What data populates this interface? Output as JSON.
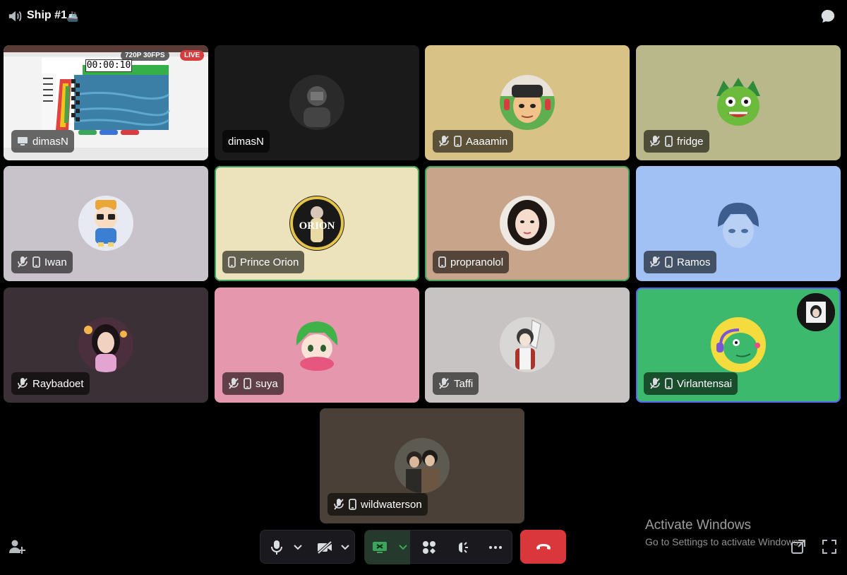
{
  "header": {
    "title": "Ship #1",
    "flag": "🚢",
    "speaker_icon": "speaker-icon",
    "chat_icon": "chat-bubble-icon"
  },
  "stream": {
    "name": "dimasN",
    "resolution": "720P 30FPS",
    "live_label": "LIVE",
    "timer": "00:00:10",
    "kind": "screen-share"
  },
  "participants": [
    {
      "name": "dimasN",
      "muted": false,
      "mobile": false,
      "bg": "#1a1a1a"
    },
    {
      "name": "Aaaamin",
      "muted": true,
      "mobile": true,
      "bg": "#d8c286"
    },
    {
      "name": "fridge",
      "muted": true,
      "mobile": true,
      "bg": "#b9b88b"
    },
    {
      "name": "Iwan",
      "muted": true,
      "mobile": true,
      "bg": "#c8c3cb"
    },
    {
      "name": "Prince Orion",
      "muted": false,
      "mobile": true,
      "bg": "#ece3bd",
      "speaking": true
    },
    {
      "name": "propranolol",
      "muted": false,
      "mobile": true,
      "bg": "#c8a48a",
      "speaking": true
    },
    {
      "name": "Ramos",
      "muted": true,
      "mobile": true,
      "bg": "#a1c0f4"
    },
    {
      "name": "Raybadoet",
      "muted": true,
      "mobile": false,
      "bg": "#3a3035"
    },
    {
      "name": "suya",
      "muted": true,
      "mobile": true,
      "bg": "#e597ae"
    },
    {
      "name": "Taffi",
      "muted": true,
      "mobile": false,
      "bg": "#c7c3c2"
    },
    {
      "name": "Virlantensai",
      "muted": true,
      "mobile": true,
      "bg": "#3cb96c",
      "selected": true
    },
    {
      "name": "wildwaterson",
      "muted": true,
      "mobile": true,
      "bg": "#4a4037"
    }
  ],
  "controls": {
    "mic_icon": "microphone-icon",
    "camera_icon": "camera-off-icon",
    "share_icon": "screen-share-icon",
    "activities_icon": "activities-icon",
    "soundboard_icon": "soundboard-icon",
    "more_icon": "more-options-icon",
    "leave_icon": "hang-up-icon",
    "invite_icon": "add-person-icon",
    "popout_icon": "pop-out-icon",
    "fullscreen_icon": "fullscreen-icon"
  },
  "watermark": {
    "title": "Activate Windows",
    "subtitle": "Go to Settings to activate Windows."
  }
}
